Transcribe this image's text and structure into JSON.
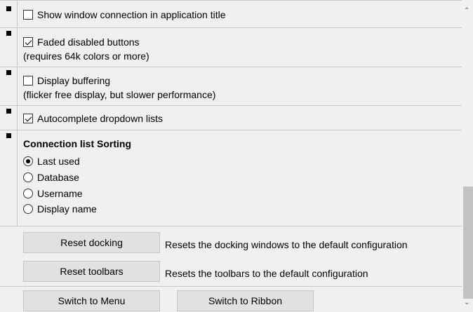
{
  "options": [
    {
      "label": "Show window connection in application title",
      "checked": false
    },
    {
      "label": "Faded disabled buttons",
      "sub": "(requires 64k colors or more)",
      "checked": true
    },
    {
      "label": "Display buffering",
      "sub": "(flicker free display, but slower performance)",
      "checked": false
    },
    {
      "label": "Autocomplete dropdown lists",
      "checked": true
    }
  ],
  "sorting": {
    "title": "Connection list Sorting",
    "options": [
      "Last used",
      "Database",
      "Username",
      "Display name"
    ],
    "selected": "Last used"
  },
  "actions": {
    "reset_docking": {
      "label": "Reset docking",
      "desc": "Resets the docking windows to the default configuration"
    },
    "reset_toolbars": {
      "label": "Reset toolbars",
      "desc": "Resets the toolbars to the default configuration"
    },
    "switch_menu": "Switch to Menu",
    "switch_ribbon": "Switch to Ribbon"
  },
  "scrollbar": {
    "up_icon": "chevron-up-icon",
    "down_icon": "chevron-down-icon"
  }
}
